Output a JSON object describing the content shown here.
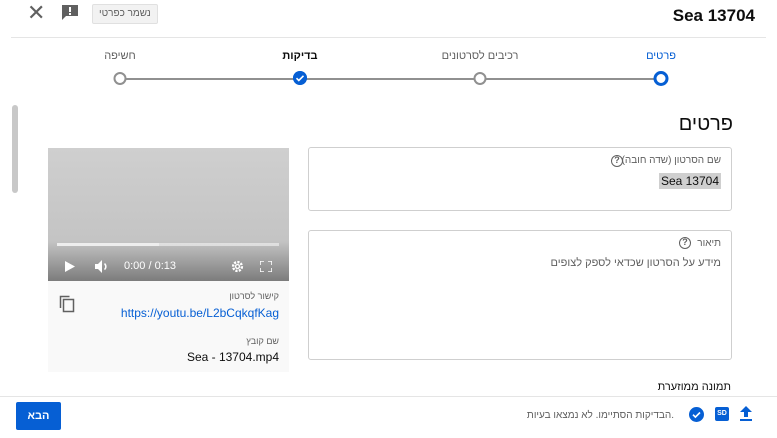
{
  "header": {
    "title": "Sea 13704",
    "saved_badge": "נשמר כפרטי"
  },
  "stepper": {
    "steps": [
      {
        "label": "פרטים",
        "state": "current"
      },
      {
        "label": "רכיבים לסרטונים",
        "state": "pending"
      },
      {
        "label": "בדיקות",
        "state": "done"
      },
      {
        "label": "חשיפה",
        "state": "pending"
      }
    ]
  },
  "section_title": "פרטים",
  "title_field": {
    "label": "שם הסרטון (שדה חובה)",
    "value": "Sea  13704"
  },
  "description_field": {
    "label": "תיאור",
    "placeholder": "מידע על הסרטון שכדאי לספק לצופים"
  },
  "video": {
    "time": "0:00 / 0:13",
    "progress": 0.46,
    "link_label": "קישור לסרטון",
    "link": "https://youtu.be/L2bCqkqfKag",
    "filename_label": "שם קובץ",
    "filename": "Sea - 13704.mp4"
  },
  "thumbnail_title": "תמונה ממוזערת",
  "footer": {
    "status": "הבדיקות הסתיימו. לא נמצאו בעיות.",
    "next_label": "הבא",
    "sd_badge": "SD"
  }
}
